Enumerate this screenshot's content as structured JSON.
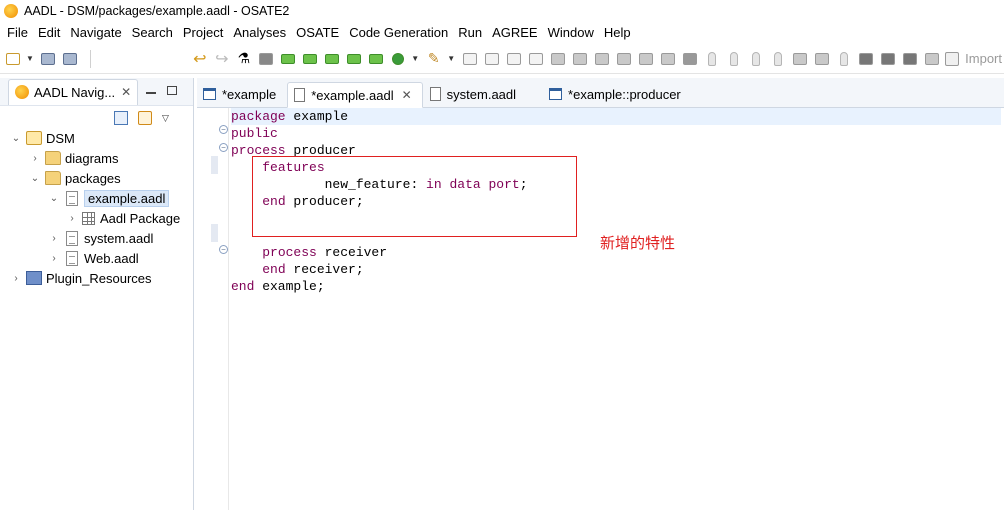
{
  "window": {
    "title": "AADL - DSM/packages/example.aadl - OSATE2"
  },
  "menu": [
    {
      "label": "File"
    },
    {
      "label": "Edit"
    },
    {
      "label": "Navigate"
    },
    {
      "label": "Search"
    },
    {
      "label": "Project"
    },
    {
      "label": "Analyses"
    },
    {
      "label": "OSATE"
    },
    {
      "label": "Code Generation"
    },
    {
      "label": "Run"
    },
    {
      "label": "AGREE"
    },
    {
      "label": "Window"
    },
    {
      "label": "Help"
    }
  ],
  "toolbar": {
    "import_label": "Import"
  },
  "navigator": {
    "tab_label": "AADL Navig...",
    "tab_close": "✕",
    "tree": [
      {
        "label": "DSM",
        "expand": "⌄"
      },
      {
        "label": "diagrams",
        "expand": "›"
      },
      {
        "label": "packages",
        "expand": "⌄"
      },
      {
        "label": "example.aadl",
        "expand": "⌄"
      },
      {
        "label": "Aadl Package",
        "expand": "›"
      },
      {
        "label": "system.aadl",
        "expand": "›"
      },
      {
        "label": "Web.aadl",
        "expand": "›"
      },
      {
        "label": "Plugin_Resources",
        "expand": "›"
      }
    ]
  },
  "editor": {
    "tabs": [
      {
        "label": "*example"
      },
      {
        "label": "*example.aadl",
        "close": "✕"
      },
      {
        "label": "system.aadl"
      },
      {
        "label": "*example::producer"
      }
    ],
    "code": {
      "l1_kw": "package",
      "l1_rest": " example",
      "l2_kw": "public",
      "l3_kw": "process",
      "l3_rest": " producer",
      "l4_kw": "features",
      "l5_name": "new_feature: ",
      "l5_kw1": "in",
      "l5_kw2": "data",
      "l5_kw3": "port",
      "l5_end": ";",
      "l6_kw": "end",
      "l6_rest": " producer;",
      "l9_kw": "process",
      "l9_rest": " receiver",
      "l10_kw": "end",
      "l10_rest": " receiver;",
      "l11_kw": "end",
      "l11_rest": " example;"
    },
    "annotation": "新增的特性",
    "annotation_color": "#e02020"
  }
}
